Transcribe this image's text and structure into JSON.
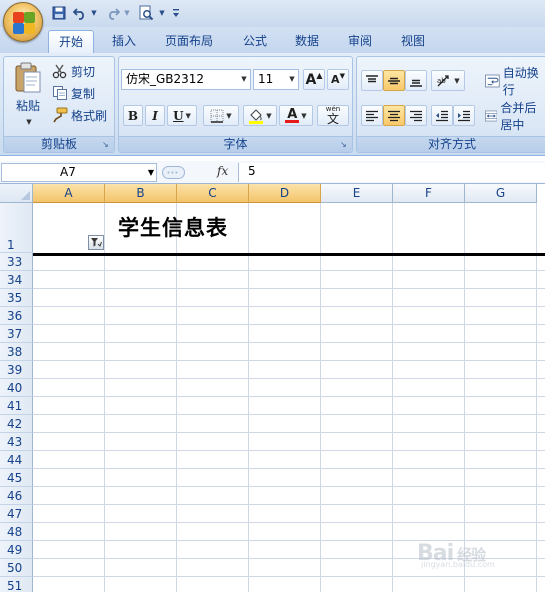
{
  "tabs": [
    "开始",
    "插入",
    "页面布局",
    "公式",
    "数据",
    "审阅",
    "视图"
  ],
  "clipboard": {
    "paste_label": "粘贴",
    "cut_label": "剪切",
    "copy_label": "复制",
    "format_painter_label": "格式刷",
    "group_label": "剪贴板"
  },
  "font": {
    "font_name": "仿宋_GB2312",
    "font_size": "11",
    "grow_label": "A",
    "shrink_label": "A",
    "bold_label": "B",
    "italic_label": "I",
    "underline_label": "U",
    "font_color_label": "A",
    "phonetic_label": "wén",
    "phonetic_char": "文",
    "group_label": "字体"
  },
  "alignment": {
    "wrap_label": "自动换行",
    "merge_label": "合并后居中",
    "group_label": "对齐方式"
  },
  "formula_bar": {
    "name_box": "A7",
    "fx_label": "fx",
    "value": "5"
  },
  "columns": [
    "A",
    "B",
    "C",
    "D",
    "E",
    "F",
    "G"
  ],
  "highlighted_columns": [
    "A",
    "B",
    "C",
    "D"
  ],
  "rows": [
    "1",
    "33",
    "34",
    "35",
    "36",
    "37",
    "38",
    "39",
    "40",
    "41",
    "42",
    "43",
    "44",
    "45",
    "46",
    "47",
    "48",
    "49",
    "50",
    "51"
  ],
  "title_cell": "学生信息表",
  "watermark": {
    "logo_text": "Bai",
    "logo_text2": "经验",
    "url": "jingyan.baidu.com"
  },
  "colors": {
    "ribbon_bg": "#dbe7f6",
    "column_header_selected": "#f4c46a",
    "text_blue": "#15428b",
    "grid_line": "#d0d7e5"
  }
}
